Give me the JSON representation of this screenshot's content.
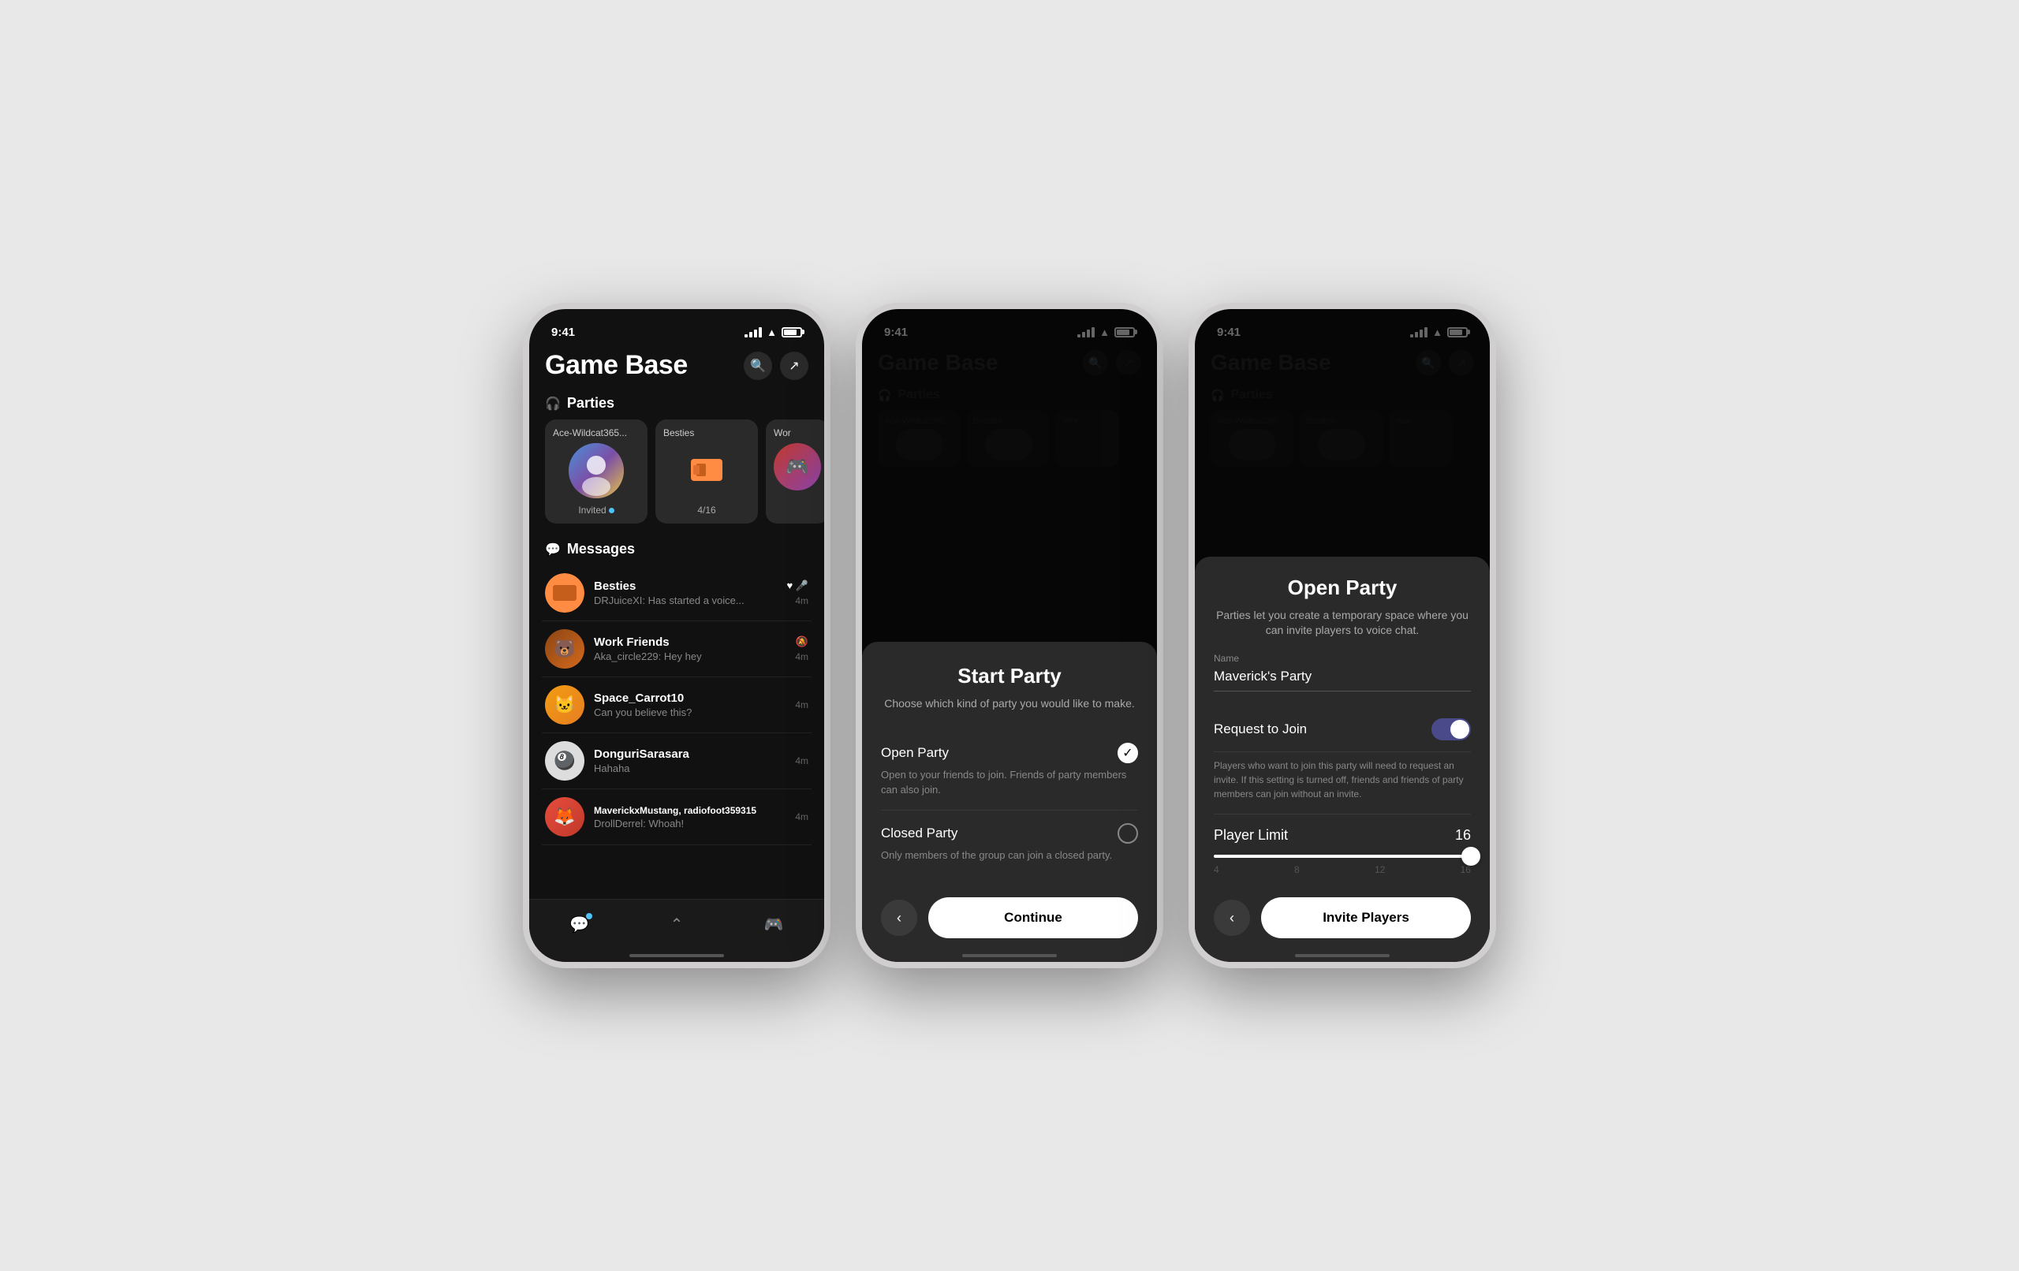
{
  "screen1": {
    "statusBar": {
      "time": "9:41"
    },
    "header": {
      "title": "Game Base"
    },
    "parties": {
      "sectionLabel": "Parties",
      "items": [
        {
          "name": "Ace-Wildcat365...",
          "status": "Invited",
          "hasInviteDot": true
        },
        {
          "name": "Besties",
          "status": "4/16",
          "hasInviteDot": false
        },
        {
          "name": "Wor",
          "status": "",
          "hasInviteDot": false
        }
      ]
    },
    "messages": {
      "sectionLabel": "Messages",
      "items": [
        {
          "name": "Besties",
          "preview": "DRJuiceXI: Has started a voice...",
          "time": "4m",
          "hasHeart": true,
          "hasMic": true,
          "muted": false
        },
        {
          "name": "Work Friends",
          "preview": "Aka_circle229: Hey hey",
          "time": "4m",
          "hasHeart": false,
          "hasMic": false,
          "muted": true
        },
        {
          "name": "Space_Carrot10",
          "preview": "Can you believe this?",
          "time": "4m",
          "hasHeart": false,
          "hasMic": false,
          "muted": false
        },
        {
          "name": "DonguriSarasara",
          "preview": "Hahaha",
          "time": "4m",
          "hasHeart": false,
          "hasMic": false,
          "muted": false
        },
        {
          "name": "MaverickxMustang, radiofoot359315",
          "preview": "DrollDerrel: Whoah!",
          "time": "4m",
          "hasHeart": false,
          "hasMic": false,
          "muted": false
        }
      ]
    },
    "nav": {
      "items": [
        "💬",
        "🏠",
        "🎮"
      ]
    }
  },
  "screen2": {
    "statusBar": {
      "time": "9:41"
    },
    "header": {
      "title": "Game Base"
    },
    "modal": {
      "title": "Start Party",
      "subtitle": "Choose which kind of party you would like to make.",
      "options": [
        {
          "name": "Open Party",
          "selected": true,
          "description": "Open to your friends to join. Friends of party members can also join."
        },
        {
          "name": "Closed Party",
          "selected": false,
          "description": "Only members of the group can join a closed party."
        }
      ],
      "backLabel": "‹",
      "continueLabel": "Continue"
    }
  },
  "screen3": {
    "statusBar": {
      "time": "9:41"
    },
    "header": {
      "title": "Game Base"
    },
    "modal": {
      "title": "Open Party",
      "subtitle": "Parties let you create a temporary space where you can invite players to voice chat.",
      "nameLabel": "Name",
      "nameValue": "Maverick's Party",
      "requestToJoinLabel": "Request to Join",
      "requestToJoinOn": true,
      "requestToJoinDesc": "Players who want to join this party will need to request an invite. If this setting is turned off, friends and friends of party members can join without an invite.",
      "playerLimitLabel": "Player Limit",
      "playerLimitValue": "16",
      "sliderMin": "4",
      "sliderMarks": [
        "4",
        "8",
        "12",
        "16"
      ],
      "backLabel": "‹",
      "invitePlayersLabel": "Invite Players"
    }
  }
}
